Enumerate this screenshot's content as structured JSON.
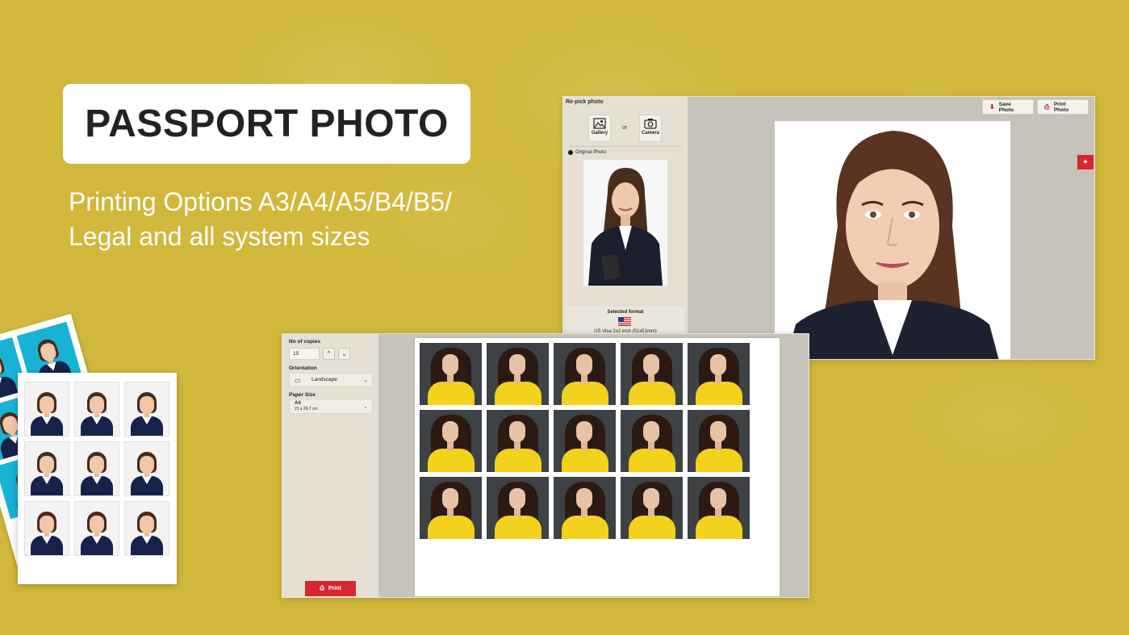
{
  "hero": {
    "title": "PASSPORT PHOTO",
    "subtitle_line1": "Printing Options A3/A4/A5/B4/B5/",
    "subtitle_line2": "Legal and all system sizes"
  },
  "editor": {
    "repick_label": "Re-pick photo",
    "gallery_label": "Gallery",
    "or_label": "or",
    "camera_label": "Camera",
    "original_photo_label": "Original Photo",
    "selected_format_title": "Selected format",
    "selected_format_name": "US Visa 2x2 inch (51x51mm)",
    "save_photo_label": "Save Photo",
    "print_photo_label": "Print Photo",
    "accent_color": "#d6262f"
  },
  "print": {
    "copies_label": "No of copies",
    "copies_value": "15",
    "orientation_label": "Orientation",
    "orientation_value": "Landscape",
    "paper_size_label": "Paper Size",
    "paper_size_value": "A4",
    "paper_size_dims": "21 x 29.7 cm",
    "print_button_label": "Print",
    "photo_count": 15,
    "icons": [
      "landscape-icon",
      "chevron-down-icon",
      "chevron-up-icon",
      "printer-icon"
    ]
  }
}
